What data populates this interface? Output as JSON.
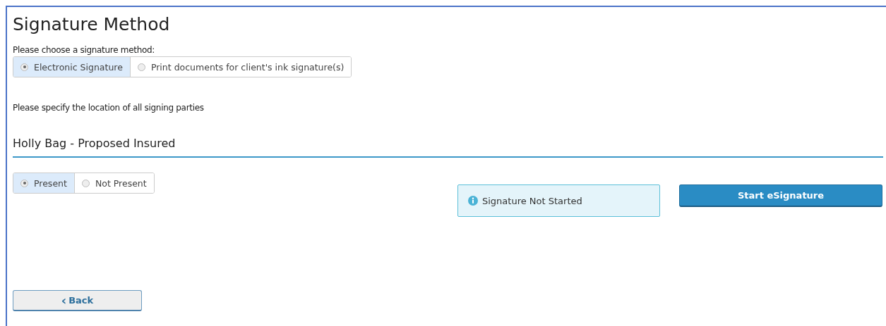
{
  "title": "Signature Method",
  "method_prompt": "Please choose a signature method:",
  "methods": [
    {
      "label": "Electronic Signature",
      "selected": true
    },
    {
      "label": "Print documents for client's ink signature(s)",
      "selected": false
    }
  ],
  "location_prompt": "Please specify the location of all signing parties",
  "party": {
    "name": "Holly Bag - Proposed Insured",
    "presence": [
      {
        "label": "Present",
        "selected": true
      },
      {
        "label": "Not Present",
        "selected": false
      }
    ],
    "status": "Signature Not Started",
    "action": "Start eSignature"
  },
  "back": {
    "icon": "‹",
    "label": "Back"
  }
}
